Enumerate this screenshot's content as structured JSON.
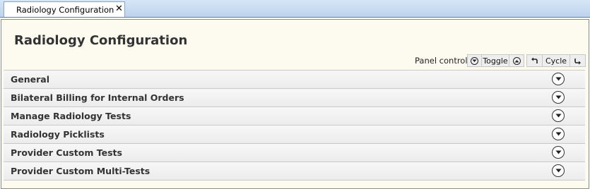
{
  "tab": {
    "label": "Radiology Configuration",
    "close_glyph": "✕"
  },
  "page": {
    "title": "Radiology Configuration"
  },
  "panel_control": {
    "label": "Panel control",
    "toggle_label": "Toggle",
    "cycle_label": "Cycle",
    "icons": [
      "expand-all-icon",
      "collapse-all-icon",
      "cycle-back-icon",
      "cycle-forward-icon"
    ]
  },
  "panels": [
    {
      "label": "General",
      "icon": "chevron-down-icon"
    },
    {
      "label": "Bilateral Billing for Internal Orders",
      "icon": "chevron-down-icon"
    },
    {
      "label": "Manage Radiology Tests",
      "icon": "chevron-down-icon"
    },
    {
      "label": "Radiology Picklists",
      "icon": "chevron-down-icon"
    },
    {
      "label": "Provider Custom Tests",
      "icon": "chevron-down-icon"
    },
    {
      "label": "Provider Custom Multi-Tests",
      "icon": "chevron-down-icon"
    }
  ]
}
